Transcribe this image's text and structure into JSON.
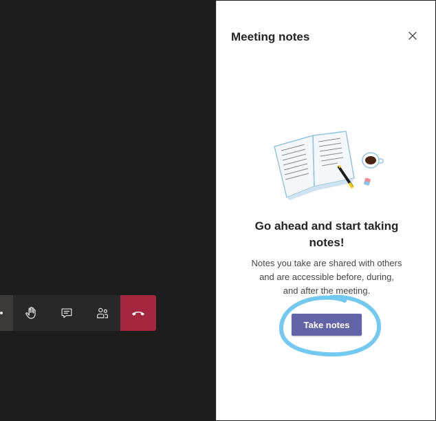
{
  "call_toolbar": {
    "buttons": [
      {
        "icon": "raise-hand-icon"
      },
      {
        "icon": "chat-icon"
      },
      {
        "icon": "participants-icon"
      },
      {
        "icon": "hang-up-icon"
      }
    ],
    "colors": {
      "bar": "#292828",
      "hangup": "#a4263f"
    }
  },
  "panel": {
    "title": "Meeting notes",
    "close_icon": "close-icon",
    "illustration": "notebook-illustration",
    "empty_state": {
      "heading": "Go ahead and start taking notes!",
      "body": "Notes you take are shared with others and are accessible before, during, and after the meeting.",
      "button_label": "Take notes"
    },
    "colors": {
      "accent": "#6264a7",
      "highlight": "#74c9f0"
    }
  }
}
